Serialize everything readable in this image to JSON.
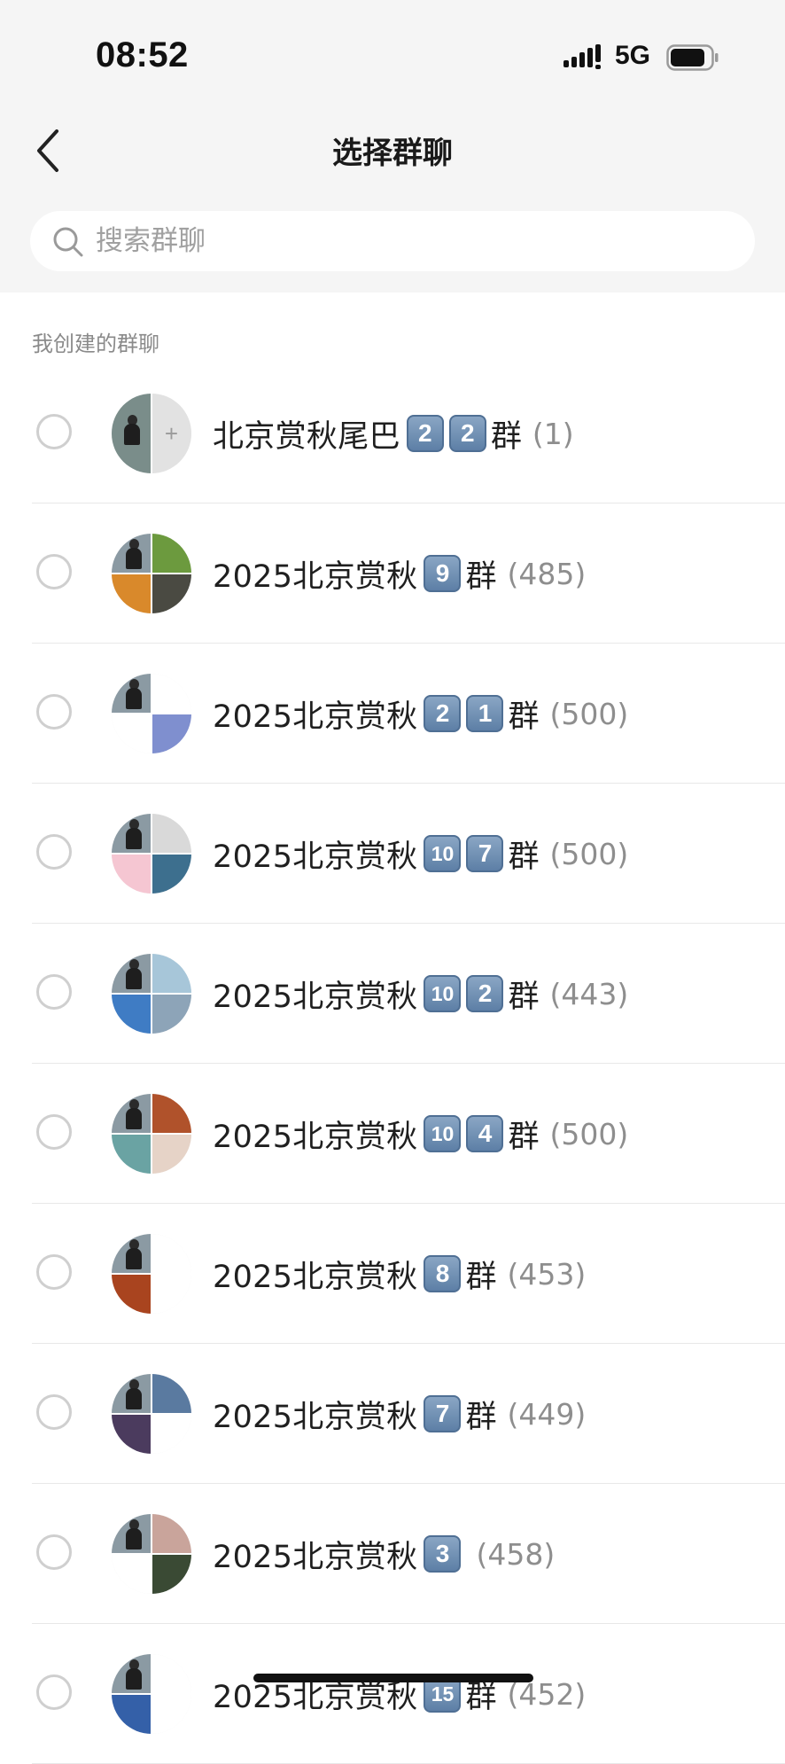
{
  "status_bar": {
    "time": "08:52",
    "network": "5G",
    "icons": [
      "signal-icon",
      "battery-icon"
    ]
  },
  "nav": {
    "title": "选择群聊",
    "back_icon": "chevron-left-icon"
  },
  "search": {
    "placeholder": "搜索群聊",
    "icon": "search-icon"
  },
  "section": {
    "label": "我创建的群聊"
  },
  "groups": [
    {
      "name": "北京赏秋尾巴",
      "badges": [
        "2",
        "2"
      ],
      "suffix": "群",
      "count": "(1)"
    },
    {
      "name": "2025北京赏秋",
      "badges": [
        "9"
      ],
      "suffix": "群",
      "count": "(485)"
    },
    {
      "name": "2025北京赏秋",
      "badges": [
        "2",
        "1"
      ],
      "suffix": "群",
      "count": "(500)"
    },
    {
      "name": "2025北京赏秋",
      "badges": [
        "10",
        "7"
      ],
      "suffix": "群",
      "count": "(500)"
    },
    {
      "name": "2025北京赏秋",
      "badges": [
        "10",
        "2"
      ],
      "suffix": "群",
      "count": "(443)"
    },
    {
      "name": "2025北京赏秋",
      "badges": [
        "10",
        "4"
      ],
      "suffix": "群",
      "count": "(500)"
    },
    {
      "name": "2025北京赏秋",
      "badges": [
        "8"
      ],
      "suffix": "群",
      "count": "(453)"
    },
    {
      "name": "2025北京赏秋",
      "badges": [
        "7"
      ],
      "suffix": "群",
      "count": "(449)"
    },
    {
      "name": "2025北京赏秋",
      "badges": [
        "3"
      ],
      "suffix": "",
      "count": "(458)"
    },
    {
      "name": "2025北京赏秋",
      "badges": [
        "15"
      ],
      "suffix": "群",
      "count": "(452)"
    }
  ],
  "colors": {
    "header_bg": "#f5f5f5",
    "badge_blue": "#5d7fa6",
    "count_gray": "#8e8e8e",
    "radio_border": "#cfcfcf"
  }
}
